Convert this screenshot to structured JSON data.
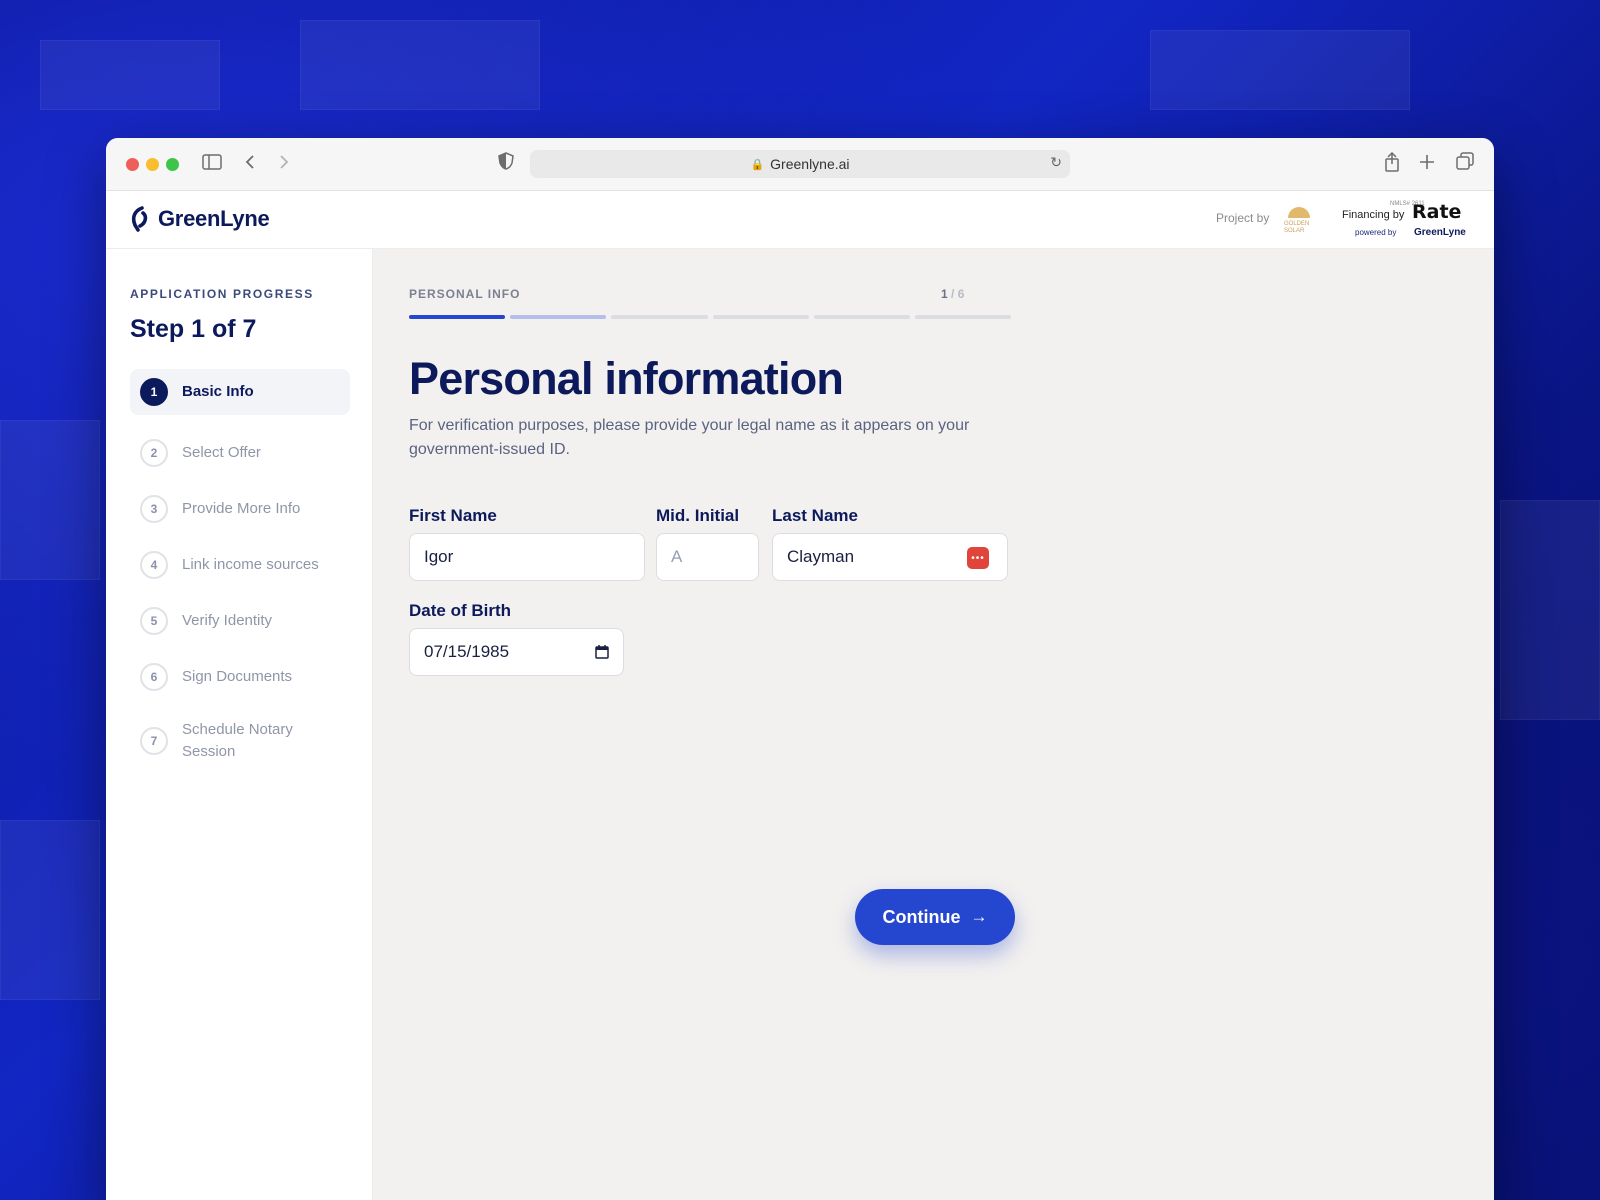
{
  "browser": {
    "url": "Greenlyne.ai"
  },
  "header": {
    "logo_text": "GreenLyne",
    "project_by": "Project by",
    "partner_logo_text": "GOLDEN SOLAR",
    "nmls": "NMLS# 2611",
    "financing_by": "Financing by",
    "lender": "Rate",
    "powered_by": "powered by",
    "powered_logo": "GreenLyne"
  },
  "sidebar": {
    "progress_label": "APPLICATION PROGRESS",
    "step_title": "Step 1 of 7",
    "steps": [
      {
        "num": "1",
        "label": "Basic Info",
        "active": true
      },
      {
        "num": "2",
        "label": "Select Offer"
      },
      {
        "num": "3",
        "label": "Provide More Info"
      },
      {
        "num": "4",
        "label": "Link income sources"
      },
      {
        "num": "5",
        "label": "Verify Identity"
      },
      {
        "num": "6",
        "label": "Sign Documents"
      },
      {
        "num": "7",
        "label": "Schedule Notary Session"
      }
    ]
  },
  "main": {
    "section_label": "PERSONAL INFO",
    "section_current": "1",
    "section_total": " / 6",
    "progress_fraction": 0.1667,
    "title": "Personal information",
    "subtitle": "For verification purposes, please provide your legal name as it appears on your government-issued ID.",
    "fields": {
      "first_name": {
        "label": "First Name",
        "value": "Igor"
      },
      "mid_initial": {
        "label": "Mid. Initial",
        "placeholder": "A"
      },
      "last_name": {
        "label": "Last Name",
        "value": "Clayman"
      },
      "dob": {
        "label": "Date of Birth",
        "value": "07/15/1985"
      }
    },
    "continue_label": "Continue"
  },
  "colors": {
    "brand_navy": "#0c1a5c",
    "accent_blue": "#2547d0",
    "password_manager_red": "#e0443a"
  }
}
